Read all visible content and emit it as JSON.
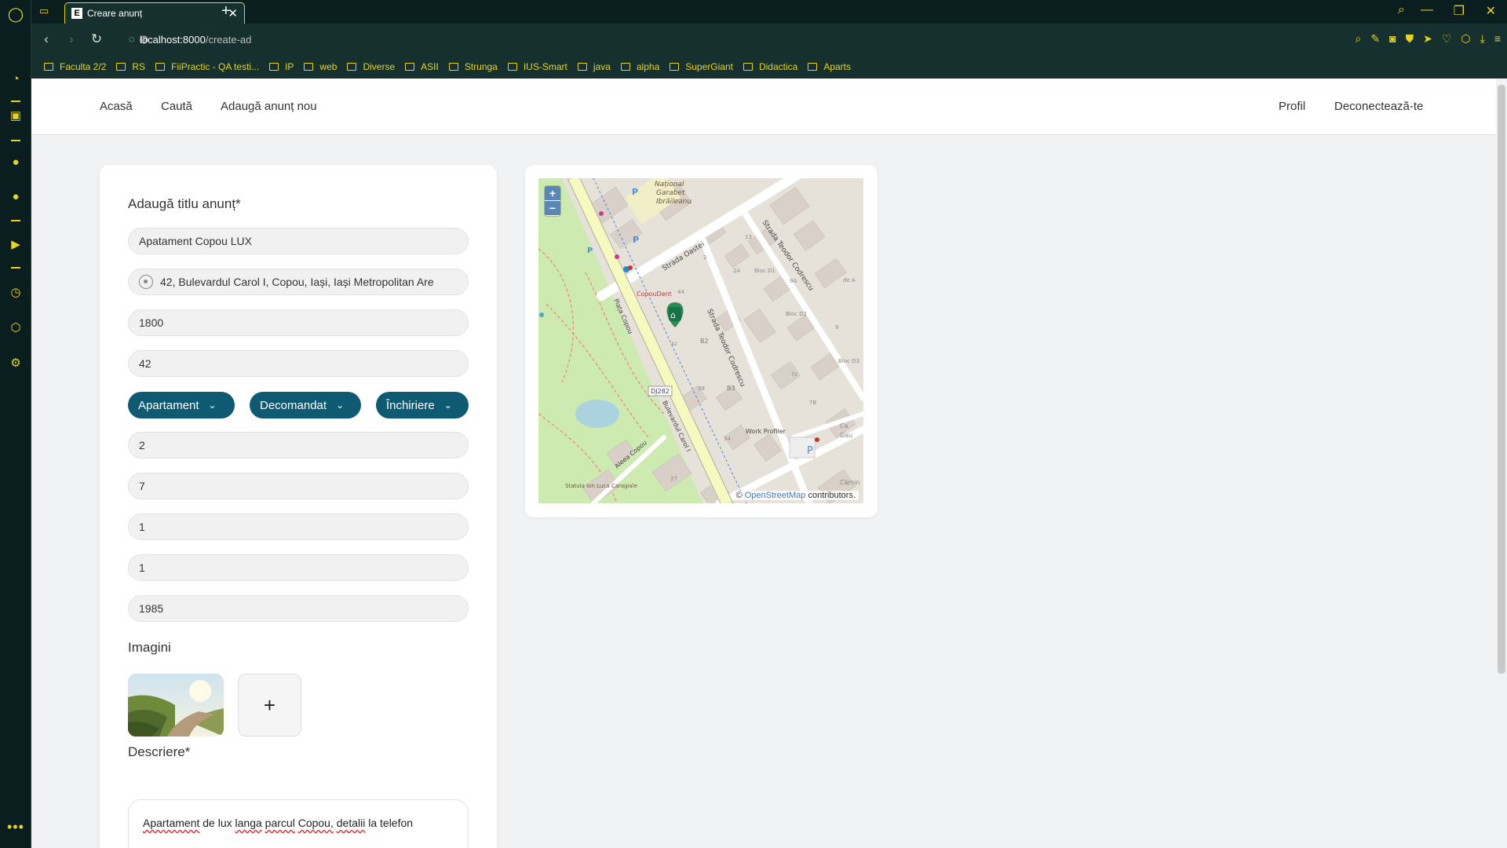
{
  "browser": {
    "tab_title": "Creare anunț",
    "tab_favicon": "E",
    "url_host": "localhost:8000",
    "url_path": "/create-ad",
    "bookmarks": [
      "Faculta 2/2",
      "RS",
      "FiiPractic - QA testi...",
      "IP",
      "web",
      "Diverse",
      "ASII",
      "Strunga",
      "IUS-Smart",
      "java",
      "alpha",
      "SuperGiant",
      "Didactica",
      "Aparts"
    ],
    "accent_color": "#e7d51c"
  },
  "nav": {
    "home": "Acasă",
    "search": "Caută",
    "add_ad": "Adaugă anunț nou",
    "profile": "Profil",
    "logout": "Deconectează-te"
  },
  "form": {
    "title_label": "Adaugă titlu anunț*",
    "title_value": "Apatament Copou LUX",
    "address_value": "42, Bulevardul Carol I, Copou, Iași, Iași Metropolitan Are",
    "price_value": "1800",
    "surface_value": "42",
    "property_type": "Apartament",
    "layout_type": "Decomandat",
    "transaction_type": "Închiriere",
    "field_rooms": "2",
    "field_floor": "7",
    "field_bathrooms": "1",
    "field_balconies": "1",
    "field_year": "1985",
    "images_label": "Imagini",
    "add_image_symbol": "+",
    "description_label": "Descriere*",
    "description_words": [
      "Apartament",
      "de lux",
      "langa",
      "parcul",
      "Copou,",
      "detalii",
      "la telefon"
    ],
    "accent_color": "#0e5a73"
  },
  "map": {
    "zoom_in": "+",
    "zoom_out": "−",
    "attribution_prefix": "©",
    "attribution_link": "OpenStreetMap",
    "attribution_suffix": "contributors.",
    "labels": {
      "national": "Național",
      "garabet": "Garabet",
      "ibraileanu": "Ibrăileanu",
      "strada_oastei": "Strada Oastei",
      "strada_teodor_codrescu_1": "Strada Teodor Codrescu",
      "strada_teodor_codrescu_2": "Strada Teodor Codrescu",
      "copoudent": "CopouDent",
      "piata_copou": "Piața Copou",
      "bulevardul_carol": "Bulevardul Carol I",
      "aleea_copou": "Aleea Copou",
      "dj282": "DJ282",
      "work_profiler": "Work Profiler",
      "statuia": "Statuia Ion Luca Caragiale",
      "bloc_d1": "Bloc D1",
      "bloc_d2": "Bloc D2",
      "bloc_d3": "Bloc D3",
      "camin": "Cămin",
      "b2": "B2",
      "b3": "B3",
      "n44": "44",
      "n34": "34",
      "n38": "38",
      "n27": "27",
      "n13": "13",
      "n2": "2",
      "n2a": "2A",
      "n9a": "9A",
      "n7c": "7c",
      "n7b": "7B",
      "n9": "9",
      "n42": "42",
      "parking": "P",
      "ca": "Ca",
      "gau": "Gau",
      "de_a": "de A"
    }
  }
}
